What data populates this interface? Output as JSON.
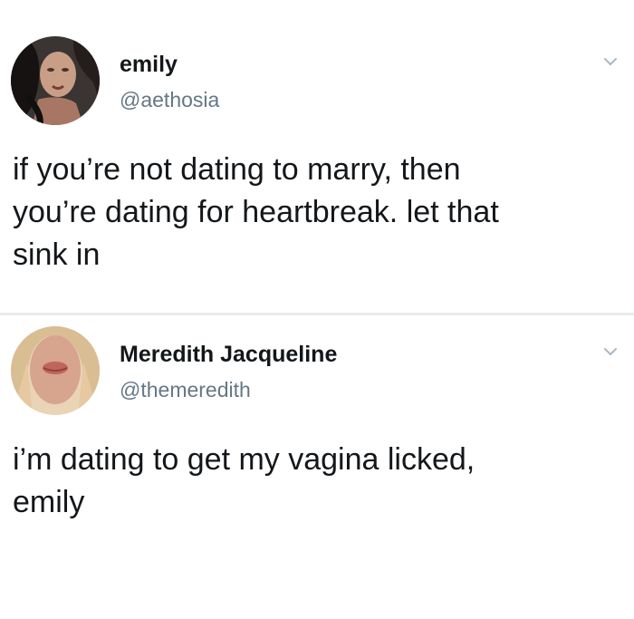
{
  "tweets": [
    {
      "display_name": "emily",
      "handle": "@aethosia",
      "text": "if you’re not dating to marry, then\nyou’re dating for heartbreak. let that\nsink in",
      "avatar_icon": "user-avatar-photo",
      "menu_icon": "chevron-down-icon"
    },
    {
      "display_name": "Meredith Jacqueline",
      "handle": "@themeredith",
      "text": "i’m dating to get my vagina licked,\nemily",
      "avatar_icon": "user-avatar-photo",
      "menu_icon": "chevron-down-icon"
    }
  ],
  "colors": {
    "name": "#14171a",
    "handle": "#657786",
    "divider": "#e9ecef",
    "chevron": "#aab8c2"
  }
}
